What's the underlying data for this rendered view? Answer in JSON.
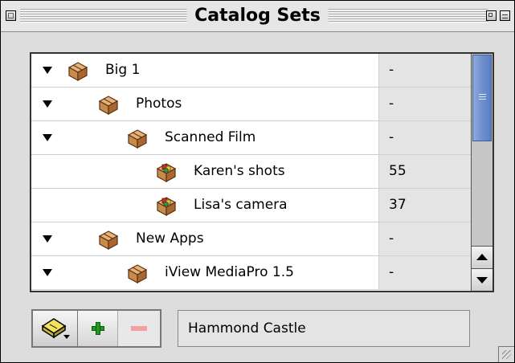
{
  "window": {
    "title": "Catalog Sets"
  },
  "list": {
    "rows": [
      {
        "label": "Big 1",
        "count": "-",
        "level": 0,
        "expanded": true,
        "icon": "catalog-set-box-icon"
      },
      {
        "label": "Photos",
        "count": "-",
        "level": 1,
        "expanded": true,
        "icon": "catalog-set-box-icon"
      },
      {
        "label": "Scanned Film",
        "count": "-",
        "level": 2,
        "expanded": true,
        "icon": "catalog-set-box-icon"
      },
      {
        "label": "Karen's shots",
        "count": "55",
        "level": 3,
        "expanded": false,
        "icon": "catalog-box-icon"
      },
      {
        "label": "Lisa's camera",
        "count": "37",
        "level": 3,
        "expanded": false,
        "icon": "catalog-box-icon"
      },
      {
        "label": "New Apps",
        "count": "-",
        "level": 1,
        "expanded": true,
        "icon": "catalog-set-box-icon"
      },
      {
        "label": "iView MediaPro 1.5",
        "count": "-",
        "level": 2,
        "expanded": true,
        "icon": "catalog-set-box-icon"
      }
    ]
  },
  "toolbar": {
    "menu_icon": "catalog-menu-icon",
    "add_icon": "plus-icon",
    "remove_icon": "minus-icon"
  },
  "name_field": {
    "value": "Hammond Castle"
  },
  "colors": {
    "scroll_thumb": "#6f8fcf",
    "add_green": "#1f9a1f",
    "remove_pink": "#f2a0a0"
  }
}
